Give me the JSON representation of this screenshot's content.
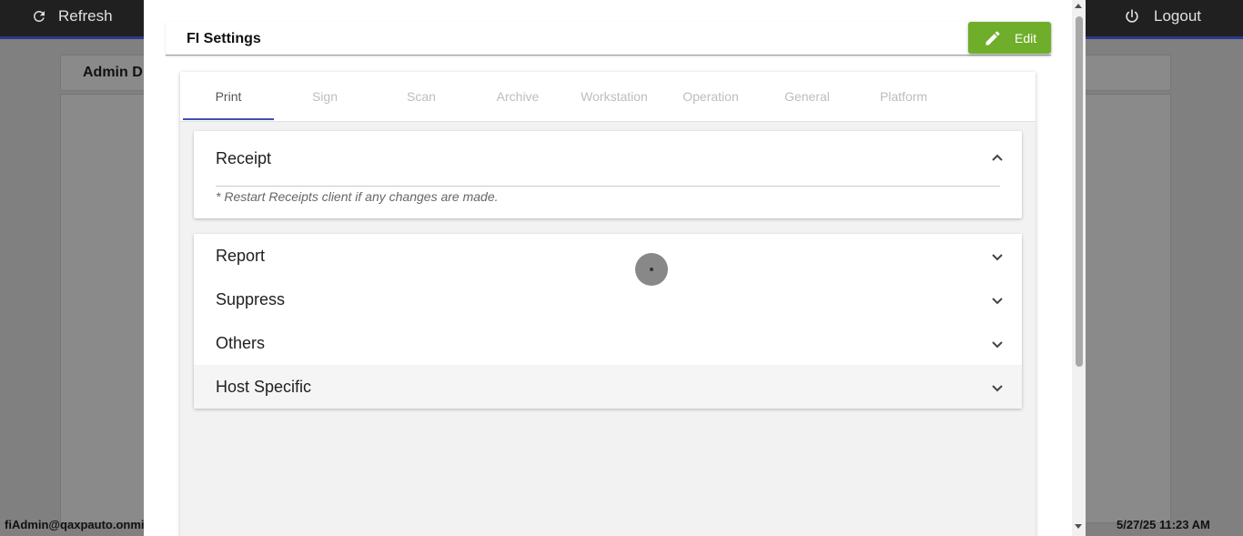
{
  "app": {
    "refresh_label": "Refresh",
    "logout_label": "Logout",
    "page_title": "Admin D",
    "user": "fiAdmin@qaxpauto.onmi",
    "datetime": "5/27/25 11:23 AM",
    "icons": {
      "refresh": "refresh-icon",
      "logout": "power-icon"
    },
    "colors": {
      "topbar": "#202020",
      "accent_line": "#2b3a8c"
    }
  },
  "dialog": {
    "title": "FI Settings",
    "edit_label": "Edit",
    "edit_icon": "pencil-icon",
    "edit_color": "#6fae2a",
    "tabs": [
      {
        "label": "Print",
        "active": true
      },
      {
        "label": "Sign"
      },
      {
        "label": "Scan"
      },
      {
        "label": "Archive"
      },
      {
        "label": "Workstation"
      },
      {
        "label": "Operation"
      },
      {
        "label": "General"
      },
      {
        "label": "Platform"
      }
    ],
    "tab_indicator_color": "#3f51b5",
    "receipt": {
      "title": "Receipt",
      "expanded": true,
      "note": "* Restart Receipts client if any changes are made."
    },
    "sections": [
      {
        "title": "Report"
      },
      {
        "title": "Suppress"
      },
      {
        "title": "Others"
      },
      {
        "title": "Host Specific"
      }
    ]
  }
}
